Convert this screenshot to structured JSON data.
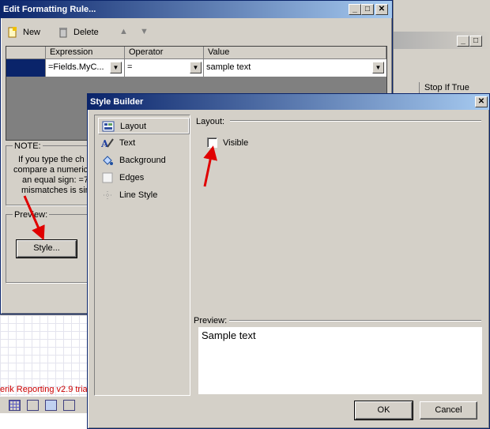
{
  "bg_window": {
    "close_label": "✕",
    "column_header": "Stop If True",
    "status_text": "erik Reporting v2.9 tria"
  },
  "edit_dialog": {
    "title": "Edit Formatting Rule...",
    "toolbar": {
      "new_label": "New",
      "delete_label": "Delete"
    },
    "grid": {
      "columns": [
        "Expression",
        "Operator",
        "Value"
      ],
      "row": {
        "expression": "=Fields.MyC...",
        "operator": "=",
        "value": "sample text"
      }
    },
    "note": {
      "label": "NOTE:",
      "lines": [
        "If you type the ch",
        "compare a numeric",
        "an equal sign: =7",
        "mismatches is sim"
      ]
    },
    "preview_label": "Preview:",
    "style_button": "Style..."
  },
  "style_builder": {
    "title": "Style Builder",
    "close_label": "✕",
    "sidebar": [
      {
        "label": "Layout",
        "icon": "layout-icon",
        "selected": true
      },
      {
        "label": "Text",
        "icon": "text-icon"
      },
      {
        "label": "Background",
        "icon": "background-icon"
      },
      {
        "label": "Edges",
        "icon": "edges-icon"
      },
      {
        "label": "Line Style",
        "icon": "line-style-icon"
      }
    ],
    "layout_section_label": "Layout:",
    "visible_checkbox": {
      "label": "Visible",
      "checked": false
    },
    "preview_label": "Preview:",
    "preview_text": "Sample text",
    "ok_label": "OK",
    "cancel_label": "Cancel"
  },
  "colors": {
    "title_active": "#0a246a",
    "selection": "#0a246a",
    "face": "#d4d0c8",
    "arrow": "#e00000",
    "status_red": "#cc0000"
  }
}
